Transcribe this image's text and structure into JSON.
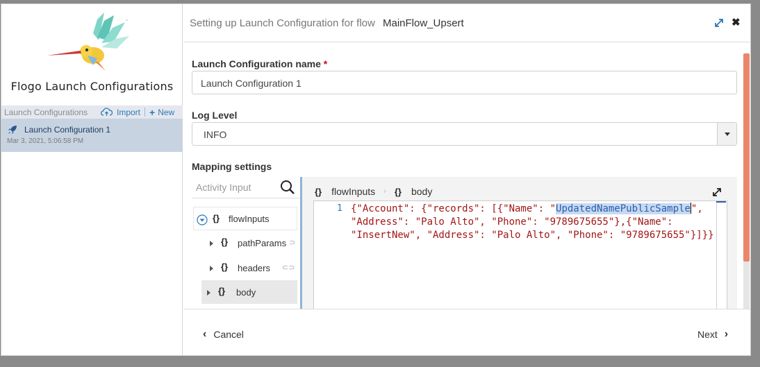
{
  "app": {
    "title": "Flogo Launch Configurations"
  },
  "sidebar": {
    "header_label": "Launch Configurations",
    "import_label": "Import",
    "new_label": "New",
    "items": [
      {
        "name": "Launch Configuration 1",
        "date": "Mar 3, 2021, 5:06:58 PM"
      }
    ]
  },
  "dialog": {
    "title_prefix": "Setting up Launch Configuration for flow",
    "flow_name": "MainFlow_Upsert"
  },
  "form": {
    "name_label": "Launch Configuration name",
    "required_mark": "*",
    "name_value": "Launch Configuration 1",
    "log_label": "Log Level",
    "log_value": "INFO",
    "mapping_label": "Mapping settings"
  },
  "mapping": {
    "search_placeholder": "Activity Input",
    "tree": {
      "root": "flowInputs",
      "children": [
        "pathParams",
        "headers",
        "body"
      ]
    },
    "breadcrumb": [
      "flowInputs",
      "body"
    ],
    "editor": {
      "line_number": "1",
      "line1_a": "{\"Account\": {\"records\": [{\"Name\": \"",
      "line1_sel": "UpdatedNamePublicSample",
      "line1_b": "\",",
      "line2": "\"Address\": \"Palo Alto\", \"Phone\": \"9789675655\"},{\"Name\":",
      "line3": "\"InsertNew\", \"Address\": \"Palo Alto\", \"Phone\": \"9789675655\"}]}}"
    }
  },
  "footer": {
    "cancel_label": "Cancel",
    "next_label": "Next"
  },
  "colors": {
    "accent": "#2a7ab8",
    "selected_item_bg": "#c8d3e2",
    "scrollbar": "#e8876a",
    "required": "#d0021b"
  }
}
